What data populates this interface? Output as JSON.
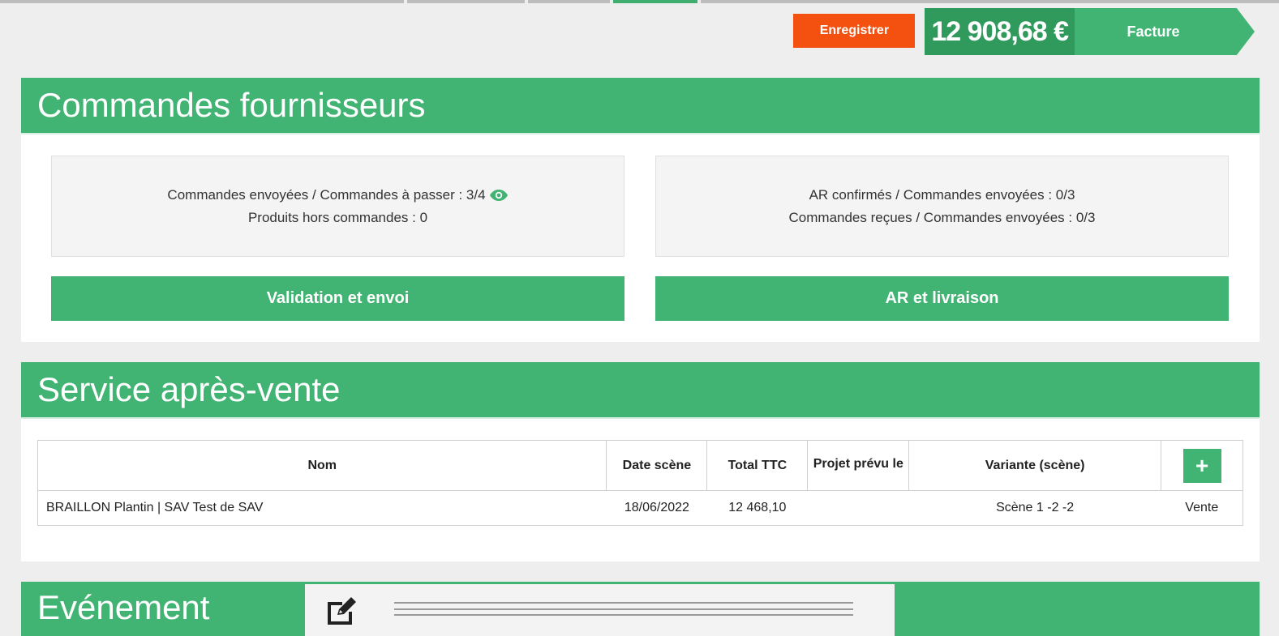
{
  "toolbar": {
    "save_label": "Enregistrer",
    "amount": "12 908,68 €",
    "facture_label": "Facture"
  },
  "colors": {
    "accent_green": "#41b373",
    "dark_green": "#2f9a5c",
    "save_orange": "#f4500f"
  },
  "commandes": {
    "title": "Commandes fournisseurs",
    "left": {
      "line1": "Commandes envoyées / Commandes à passer : 3/4",
      "line2": "Produits hors commandes : 0",
      "icon": "eye-icon"
    },
    "right": {
      "line1": "AR confirmés / Commandes envoyées : 0/3",
      "line2": "Commandes reçues / Commandes envoyées : 0/3"
    },
    "btn_validation": "Validation et envoi",
    "btn_ar": "AR et livraison"
  },
  "sav": {
    "title": "Service après-vente",
    "headers": [
      "Nom",
      "Date scène",
      "Total TTC",
      "Projet prévu le",
      "Variante (scène)"
    ],
    "add_label": "+",
    "rows": [
      {
        "nom": "BRAILLON Plantin | SAV Test de SAV",
        "date": "18/06/2022",
        "total": "12 468,10",
        "projet": "",
        "variante": "Scène 1 -2 -2",
        "type": "Vente"
      }
    ]
  },
  "evenement": {
    "title": "Evénement",
    "edit_icon": "edit-icon"
  }
}
